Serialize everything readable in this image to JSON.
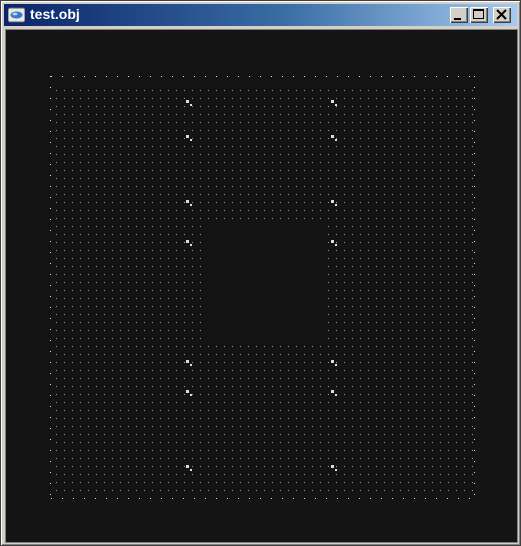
{
  "window": {
    "title": "test.obj",
    "background": "#141414",
    "point_color": "#dcdcdc"
  },
  "controls": {
    "minimize_icon": "minimize-icon",
    "maximize_icon": "maximize-icon",
    "close_icon": "close-icon"
  }
}
